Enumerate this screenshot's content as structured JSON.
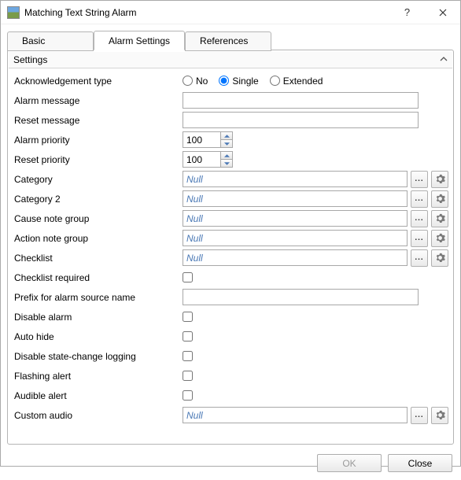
{
  "window": {
    "title": "Matching Text String Alarm"
  },
  "tabs": {
    "basic": "Basic",
    "alarm_settings": "Alarm Settings",
    "references": "References"
  },
  "section": {
    "title": "Settings"
  },
  "labels": {
    "ack_type": "Acknowledgement type",
    "alarm_message": "Alarm message",
    "reset_message": "Reset message",
    "alarm_priority": "Alarm priority",
    "reset_priority": "Reset priority",
    "category": "Category",
    "category2": "Category 2",
    "cause_note_group": "Cause note group",
    "action_note_group": "Action note group",
    "checklist": "Checklist",
    "checklist_required": "Checklist required",
    "prefix": "Prefix for alarm source name",
    "disable_alarm": "Disable alarm",
    "auto_hide": "Auto hide",
    "disable_logging": "Disable state-change logging",
    "flashing_alert": "Flashing alert",
    "audible_alert": "Audible alert",
    "custom_audio": "Custom audio"
  },
  "radio_opts": {
    "no": "No",
    "single": "Single",
    "extended": "Extended"
  },
  "values": {
    "alarm_message": "",
    "reset_message": "",
    "alarm_priority": "100",
    "reset_priority": "100",
    "prefix": "",
    "null_text": "Null",
    "ellipsis": "..."
  },
  "buttons": {
    "ok": "OK",
    "close": "Close"
  }
}
